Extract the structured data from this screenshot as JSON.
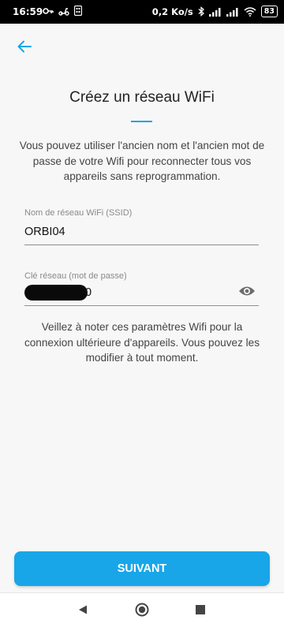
{
  "status_bar": {
    "time": "16:59",
    "speed": "0,2 Ko/s",
    "battery": "83"
  },
  "header": {
    "back_icon": "arrow-left-icon"
  },
  "page": {
    "title": "Créez un réseau WiFi",
    "description": "Vous pouvez utiliser l'ancien nom et l'ancien mot de passe de votre Wifi pour reconnecter tous vos appareils sans reprogrammation."
  },
  "ssid_field": {
    "label": "Nom de réseau WiFi (SSID)",
    "value": "ORBI04"
  },
  "password_field": {
    "label": "Clé réseau (mot de passe)",
    "value": "",
    "visible_tail": "0"
  },
  "note": "Veillez à noter ces paramètres Wifi pour la connexion ultérieure d'appareils. Vous pouvez les modifier à tout moment.",
  "next_button": {
    "label": "SUIVANT"
  },
  "colors": {
    "accent": "#18a6e8",
    "background": "#f7f7f7"
  }
}
